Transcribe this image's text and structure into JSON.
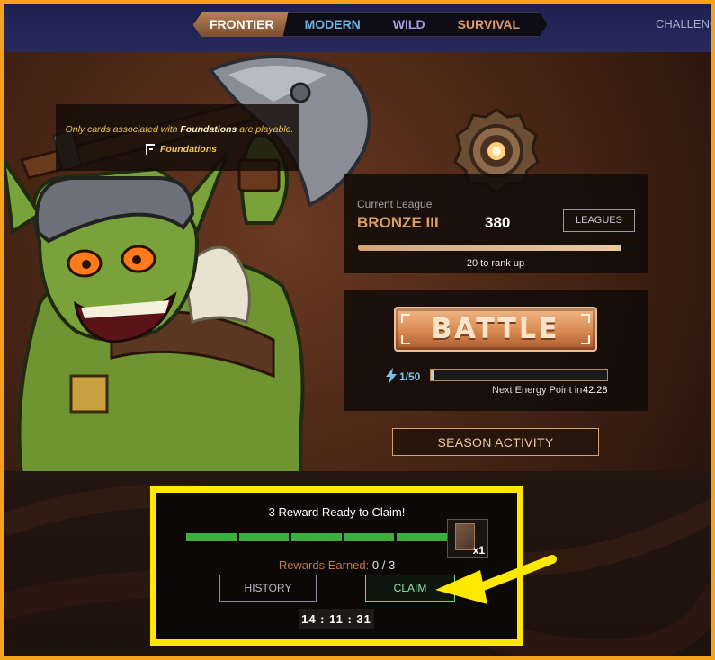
{
  "nav": {
    "tabs": [
      {
        "label": "FRONTIER",
        "active": true,
        "color": "#ffffff"
      },
      {
        "label": "MODERN",
        "active": false,
        "color": "#6fb6e6"
      },
      {
        "label": "WILD",
        "active": false,
        "color": "#a79be0"
      },
      {
        "label": "SURVIVAL",
        "active": false,
        "color": "#e29a6a"
      }
    ],
    "challenges_label": "CHALLENGES"
  },
  "restriction": {
    "text_prefix": "Only cards associated with ",
    "text_bold": "Foundations",
    "text_suffix": " are playable.",
    "set_name": "Foundations"
  },
  "league": {
    "caption": "Current League",
    "name": "BRONZE III",
    "points": "380",
    "leagues_button": "LEAGUES",
    "rank_progress_fraction": 0.95,
    "rank_text": "20 to rank up"
  },
  "battle": {
    "button_label": "BATTLE",
    "energy_count": "1/50",
    "energy_fraction": 0.02,
    "next_energy_label": "Next Energy Point in",
    "next_energy_time": "42:28"
  },
  "season_activity_label": "SEASON ACTIVITY",
  "rewards": {
    "title": "3 Reward Ready to Claim!",
    "segments_filled": 5,
    "segments_total": 5,
    "chest_multiplier": "x1",
    "earned_label": "Rewards Earned:",
    "earned_count": "0 / 3",
    "history_label": "HISTORY",
    "claim_label": "CLAIM",
    "timer": "14 : 11 : 31"
  },
  "colors": {
    "highlight": "#ffe800",
    "frame": "#f7a21b",
    "accent_bronze": "#d9a064",
    "progress_green": "#3eae3a"
  }
}
